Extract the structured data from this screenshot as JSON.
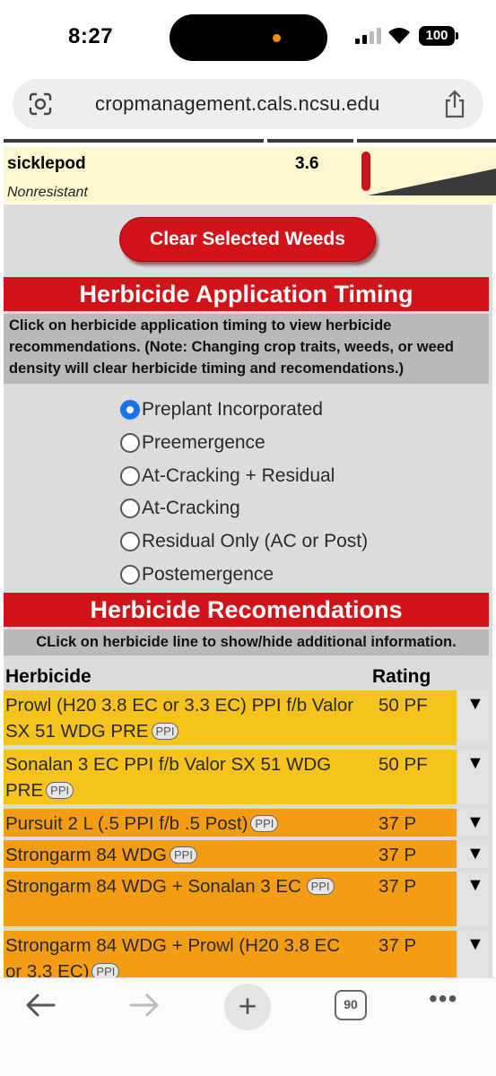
{
  "status_bar": {
    "time": "8:27",
    "battery": "100"
  },
  "browser": {
    "url": "cropmanagement.cals.ncsu.edu"
  },
  "weed": {
    "name": "sicklepod",
    "resistance": "Nonresistant",
    "density": "3.6"
  },
  "clear_button": "Clear Selected Weeds",
  "timing": {
    "title": "Herbicide Application Timing",
    "description": "Click on herbicide application timing to view herbicide recommendations. (Note: Changing crop traits, weeds, or weed density will clear herbicide timing and recomendations.)",
    "options": [
      {
        "label": "Preplant Incorporated",
        "checked": true
      },
      {
        "label": "Preemergence",
        "checked": false
      },
      {
        "label": "At-Cracking + Residual",
        "checked": false
      },
      {
        "label": "At-Cracking",
        "checked": false
      },
      {
        "label": "Residual Only (AC or Post)",
        "checked": false
      },
      {
        "label": "Postemergence",
        "checked": false
      }
    ]
  },
  "recommendations": {
    "title": "Herbicide Recomendations",
    "description": "CLick on herbicide line to show/hide additional information.",
    "col_herbicide": "Herbicide",
    "col_rating": "Rating",
    "toggle_glyph": "▼",
    "badge": "PPI",
    "rows": [
      {
        "name": "Prowl (H20 3.8 EC or 3.3 EC) PPI f/b Valor SX 51 WDG PRE",
        "rating": "50 PF",
        "color": "#f6c21c"
      },
      {
        "name": "Sonalan 3 EC PPI f/b Valor SX 51 WDG PRE",
        "rating": "50 PF",
        "color": "#f6c21c"
      },
      {
        "name": "Pursuit 2 L (.5 PPI f/b .5 Post)",
        "rating": "37 P",
        "color": "#f49d14"
      },
      {
        "name": "Strongarm 84 WDG",
        "rating": "37 P",
        "color": "#f49d14"
      },
      {
        "name": "Strongarm 84 WDG + Sonalan 3 EC",
        "rating": "37 P",
        "color": "#f49d14"
      },
      {
        "name": "Strongarm 84 WDG + Prowl (H20 3.8 EC or 3.3 EC)",
        "rating": "37 P",
        "color": "#f49d14"
      }
    ]
  },
  "toolbar": {
    "tab_count": "90"
  }
}
